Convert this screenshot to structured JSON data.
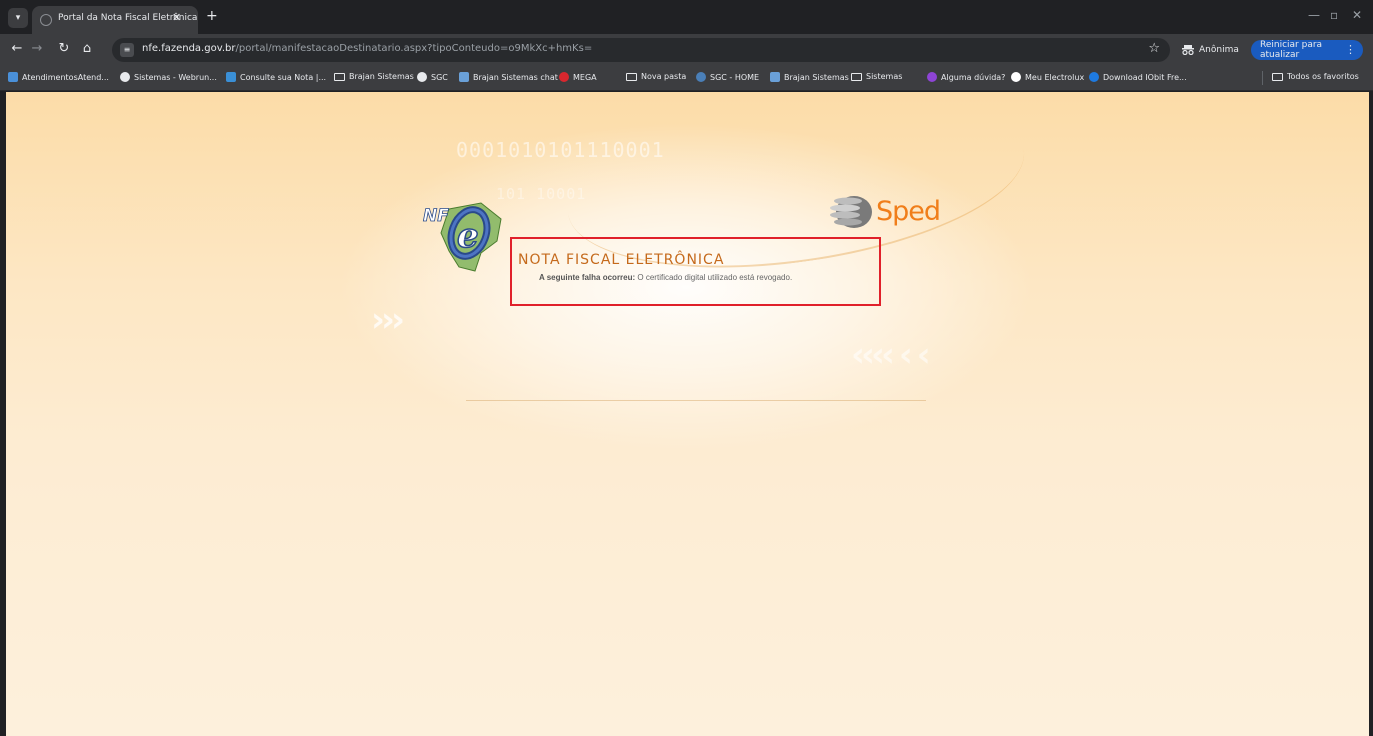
{
  "browser": {
    "tab_title": "Portal da Nota Fiscal Eletrônica",
    "tab_close": "✕",
    "new_tab": "+",
    "url_host": "nfe.fazenda.gov.br",
    "url_path": "/portal/manifestacaoDestinatario.aspx?tipoConteudo=o9MkXc+hmKs=",
    "incognito_label": "Anônima",
    "restart_label": "Reiniciar para atualizar"
  },
  "bookmarks": [
    {
      "label": "AtendimentosAtend...",
      "icon": "chat-icon",
      "color": "#4a90d9"
    },
    {
      "label": "Sistemas - Webrun...",
      "icon": "globe-icon",
      "color": "#e8eaed"
    },
    {
      "label": "Consulte sua Nota |...",
      "icon": "consulte-icon",
      "color": "#3a8fd6"
    },
    {
      "label": "Brajan Sistemas",
      "icon": "folder-icon",
      "color": "#e8eaed"
    },
    {
      "label": "SGC",
      "icon": "globe-icon",
      "color": "#e8eaed"
    },
    {
      "label": "Brajan Sistemas  chat",
      "icon": "brajan-icon",
      "color": "#6aa0d8"
    },
    {
      "label": "MEGA",
      "icon": "mega-icon",
      "color": "#d9272e"
    },
    {
      "label": "Nova pasta",
      "icon": "folder-icon",
      "color": "#e8eaed"
    },
    {
      "label": "SGC - HOME",
      "icon": "globe-icon",
      "color": "#4a7fb8"
    },
    {
      "label": "Brajan Sistemas",
      "icon": "brajan-icon",
      "color": "#6aa0d8"
    },
    {
      "label": "Sistemas",
      "icon": "folder-icon",
      "color": "#e8eaed"
    },
    {
      "label": "Alguma dúvida?",
      "icon": "question-icon",
      "color": "#8e44d6"
    },
    {
      "label": "Meu Electrolux",
      "icon": "electrolux-icon",
      "color": "#ffffff"
    },
    {
      "label": "Download IObit Fre...",
      "icon": "iobit-icon",
      "color": "#1e7ae0"
    },
    {
      "label": "Todos os favoritos",
      "icon": "folder-icon",
      "color": "#e8eaed"
    }
  ],
  "page": {
    "binary_top": "0001010101110001",
    "binary_mid": "101 10001",
    "nfe_logo_text": "NF",
    "nfe_logo_e": "e",
    "sped_text": "Sped",
    "title": "NOTA FISCAL ELETRÔNICA",
    "error_prefix": "A seguinte falha ocorreu:",
    "error_message": "O certificado digital utilizado está revogado."
  }
}
